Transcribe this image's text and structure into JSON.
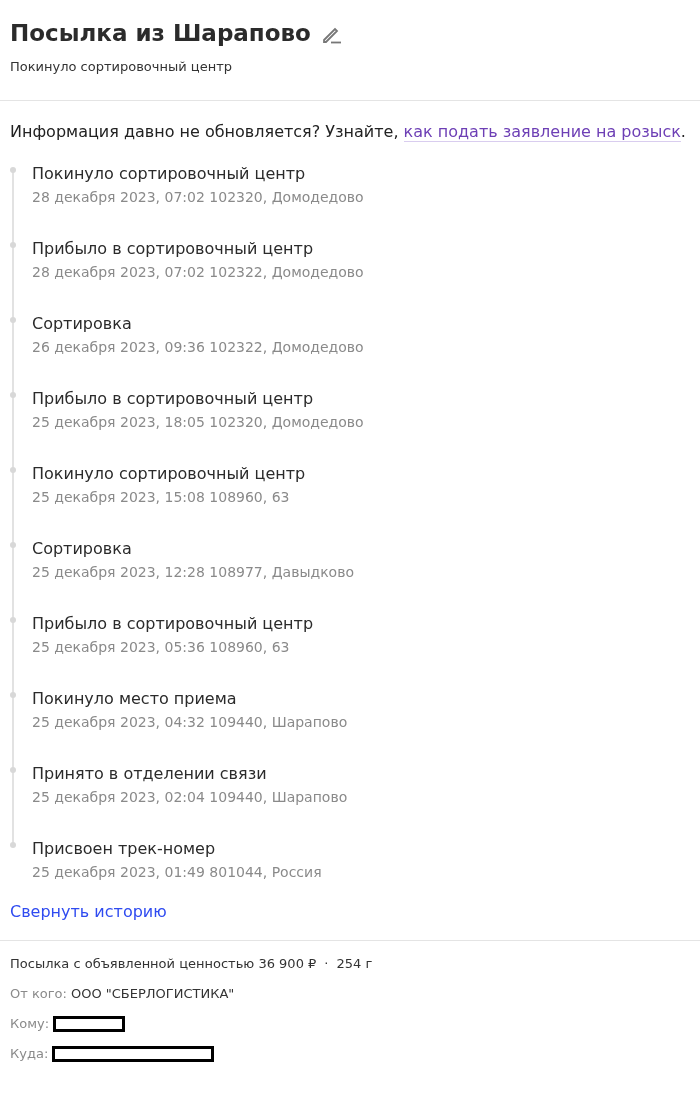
{
  "title": "Посылка из Шарапово",
  "status": "Покинуло сортировочный центр",
  "notice": {
    "text": "Информация давно не обновляется? Узнайте, ",
    "link": "как подать заявление на розыск",
    "end": "."
  },
  "events": [
    {
      "title": "Покинуло сортировочный центр",
      "details": "28 декабря 2023, 07:02 102320, Домодедово"
    },
    {
      "title": "Прибыло в сортировочный центр",
      "details": "28 декабря 2023, 07:02 102322, Домодедово"
    },
    {
      "title": "Сортировка",
      "details": "26 декабря 2023, 09:36 102322, Домодедово"
    },
    {
      "title": "Прибыло в сортировочный центр",
      "details": "25 декабря 2023, 18:05 102320, Домодедово"
    },
    {
      "title": "Покинуло сортировочный центр",
      "details": "25 декабря 2023, 15:08 108960, 63"
    },
    {
      "title": "Сортировка",
      "details": "25 декабря 2023, 12:28 108977, Давыдково"
    },
    {
      "title": "Прибыло в сортировочный центр",
      "details": "25 декабря 2023, 05:36 108960, 63"
    },
    {
      "title": "Покинуло место приема",
      "details": "25 декабря 2023, 04:32 109440, Шарапово"
    },
    {
      "title": "Принято в отделении связи",
      "details": "25 декабря 2023, 02:04 109440, Шарапово"
    },
    {
      "title": "Присвоен трек-номер",
      "details": "25 декабря 2023, 01:49 801044, Россия"
    }
  ],
  "collapse_link": "Свернуть историю",
  "summary": {
    "value": "Посылка с объявленной ценностью 36 900 ₽",
    "separator": "·",
    "weight": "254 г"
  },
  "fields": [
    {
      "label": "От кого:",
      "value": "ООО \"СБЕРЛОГИСТИКА\""
    },
    {
      "label": "Кому:",
      "kind": "redacted"
    },
    {
      "label": "Куда:",
      "kind": "redacted"
    }
  ]
}
